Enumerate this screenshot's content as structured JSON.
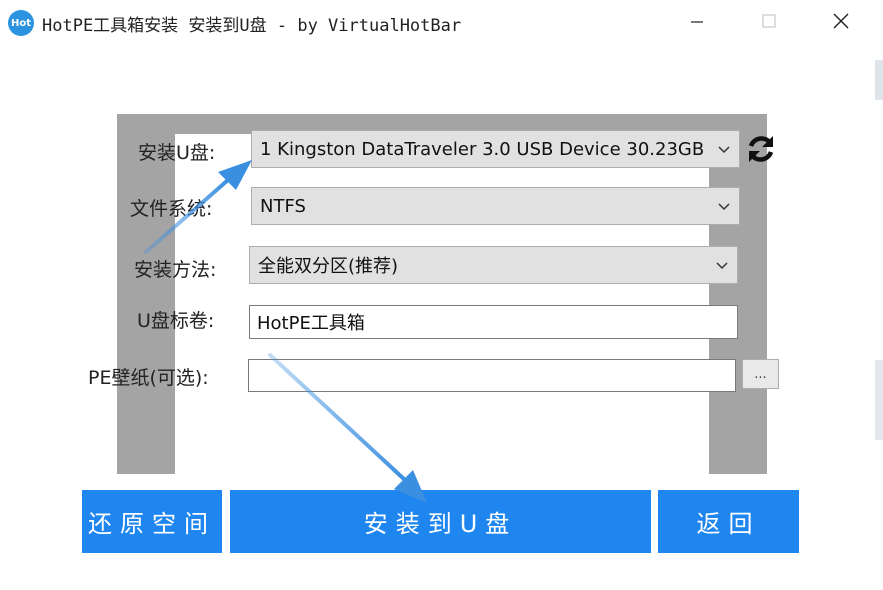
{
  "window": {
    "logo_text": "Hot",
    "title": "HotPE工具箱安装 安装到U盘 - by VirtualHotBar"
  },
  "form": {
    "usb_label": "安装U盘:",
    "usb_value": "1 Kingston DataTraveler 3.0 USB Device 30.23GB",
    "fs_label": "文件系统:",
    "fs_value": "NTFS",
    "method_label": "安装方法:",
    "method_value": "全能双分区(推荐)",
    "volume_label": "U盘标卷:",
    "volume_value": "HotPE工具箱",
    "wallpaper_label": "PE壁纸(可选):",
    "wallpaper_value": "",
    "browse_label": "..."
  },
  "buttons": {
    "restore": "还原空间",
    "install": "安装到U盘",
    "back": "返回"
  },
  "colors": {
    "accent": "#1f86ef",
    "annotation_arrow": "#3b8fe0",
    "shade": "#a4a4a4"
  },
  "icons": {
    "refresh": "refresh-icon",
    "minimize": "minimize-icon",
    "maximize": "maximize-icon",
    "close": "close-icon",
    "dropdown": "chevron-down-icon"
  }
}
